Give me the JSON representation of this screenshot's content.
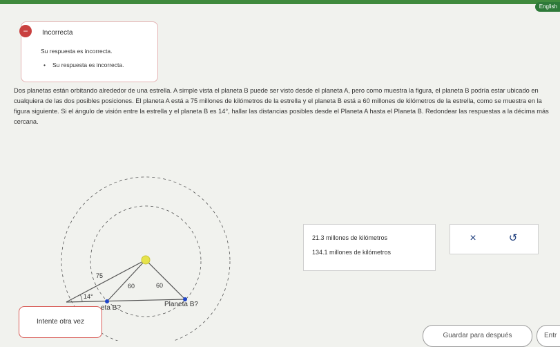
{
  "header": {
    "language_button": "English"
  },
  "feedback": {
    "icon": "error-icon",
    "title": "Incorrecta",
    "message": "Su respuesta es incorrecta.",
    "bullet": "Su respuesta es incorrecta."
  },
  "problem": {
    "text": "Dos planetas están orbitando alrededor de una estrella. A simple vista el planeta B puede ser visto desde el planeta A, pero como muestra la figura, el planeta B podría estar ubicado en cualquiera de las dos posibles posiciones. El planeta A está a 75 millones de kilómetros de la estrella y el planeta B está a 60 millones de kilómetros de la estrella, como se muestra en la figura siguiente. Si el ángulo de visión entre la estrella y el planeta B es 14°, hallar las distancias posibles desde el Planeta A hasta el Planeta B. Redondear las respuestas a la décima más cercana."
  },
  "figure": {
    "label_75": "75",
    "label_60_left": "60",
    "label_60_right": "60",
    "label_angle": "14°",
    "label_planet_b_left": "eta B?",
    "label_planet_b_right": "Planeta B?"
  },
  "answers": {
    "items": [
      "21.3 millones de kilómetros",
      "134.1 millones de kilómetros"
    ]
  },
  "actions": {
    "clear_symbol": "×",
    "undo_symbol": "↺"
  },
  "footer": {
    "retry_label": "Intente otra vez",
    "save_label": "Guardar para después",
    "enter_label": "Entr"
  }
}
